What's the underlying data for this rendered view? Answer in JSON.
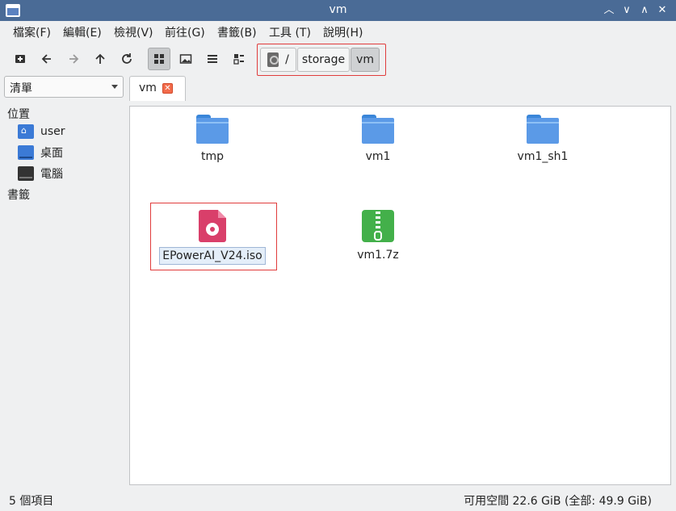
{
  "window": {
    "title": "vm"
  },
  "menubar": {
    "items": [
      "檔案(F)",
      "編輯(E)",
      "檢視(V)",
      "前往(G)",
      "書籤(B)",
      "工具 (T)",
      "說明(H)"
    ]
  },
  "pathbar": {
    "crumbs": [
      "/",
      "storage",
      "vm"
    ]
  },
  "sidebar": {
    "view_mode": "清單",
    "places_heading": "位置",
    "places": [
      {
        "label": "user",
        "icon": "home-folder-icon"
      },
      {
        "label": "桌面",
        "icon": "desktop-icon"
      },
      {
        "label": "電腦",
        "icon": "computer-icon"
      }
    ],
    "bookmarks_heading": "書籤"
  },
  "tab": {
    "label": "vm"
  },
  "files": [
    {
      "name": "tmp",
      "type": "folder"
    },
    {
      "name": "vm1",
      "type": "folder"
    },
    {
      "name": "vm1_sh1",
      "type": "folder"
    },
    {
      "name": "EPowerAI_V24.iso",
      "type": "iso",
      "selected": true
    },
    {
      "name": "vm1.7z",
      "type": "archive"
    }
  ],
  "status": {
    "count": "5 個項目",
    "free_space": "可用空間 22.6 GiB (全部: 49.9 GiB)"
  },
  "colors": {
    "titlebar": "#4a6b96",
    "accent": "#3b7ad6",
    "highlight": "#e03c3c"
  }
}
